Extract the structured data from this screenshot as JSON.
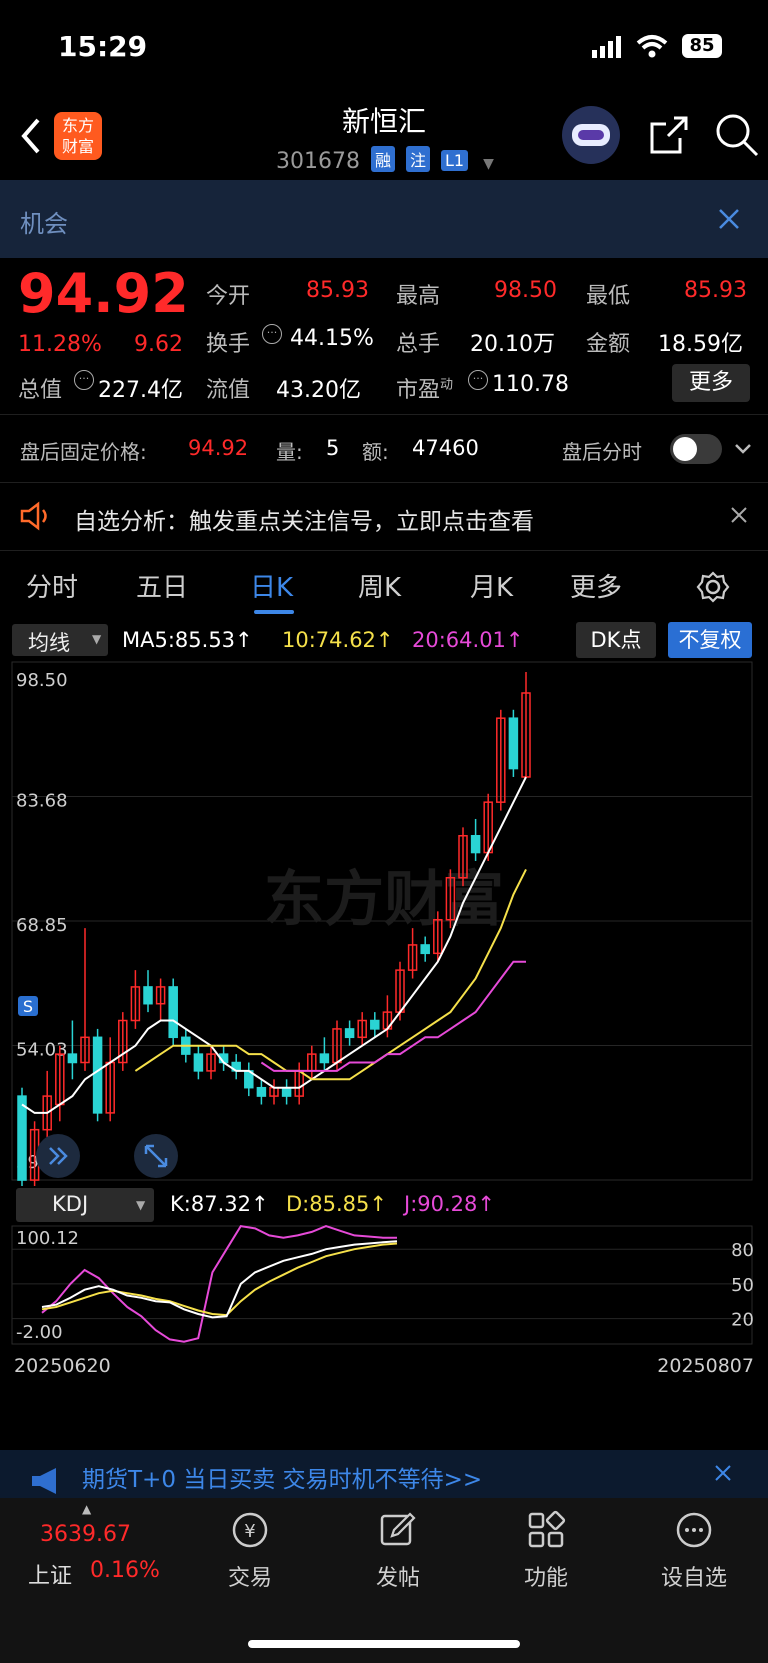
{
  "status_bar": {
    "time": "15:29",
    "battery": "85"
  },
  "header": {
    "title": "新恒汇",
    "code": "301678",
    "tags": [
      "融",
      "注",
      "L1"
    ],
    "logo_line1": "东方",
    "logo_line2": "财富"
  },
  "banner": {
    "text": "机会"
  },
  "quote": {
    "price": "94.92",
    "change_pct": "11.28%",
    "change": "9.62",
    "open_label": "今开",
    "open": "85.93",
    "high_label": "最高",
    "high": "98.50",
    "low_label": "最低",
    "low": "85.93",
    "turnover_label": "换手",
    "turnover": "44.15%",
    "volume_label": "总手",
    "volume": "20.10万",
    "amount_label": "金额",
    "amount": "18.59亿",
    "mcap_label": "总值",
    "mcap": "227.4亿",
    "float_label": "流值",
    "float_cap": "43.20亿",
    "pe_label": "市盈",
    "pe_sup": "动",
    "pe": "110.78",
    "more_button": "更多"
  },
  "after_hours": {
    "label": "盘后固定价格:",
    "price": "94.92",
    "vol_label": "量:",
    "vol": "5",
    "amt_label": "额:",
    "amt": "47460",
    "toggle_label": "盘后分时"
  },
  "notice": {
    "text": "自选分析：触发重点关注信号，立即点击查看"
  },
  "tabs": [
    "分时",
    "五日",
    "日K",
    "周K",
    "月K",
    "更多"
  ],
  "active_tab": "日K",
  "chart_data": {
    "type": "candlestick",
    "indicator_selector": "均线",
    "ma_labels": [
      "MA5:85.53↑",
      "10:74.62↑",
      "20:64.01↑"
    ],
    "dk_button": "DK点",
    "adjust_button": "不复权",
    "price_ticks": [
      "98.50",
      "83.68",
      "68.85",
      "54.03",
      "39.20"
    ],
    "watermark": "东方财富",
    "kdj_selector": "KDJ",
    "kdj_labels": [
      "K:87.32↑",
      "D:85.85↑",
      "J:90.28↑"
    ],
    "kdj_ticks_left": [
      "100.12",
      "-2.00"
    ],
    "kdj_ticks_right": [
      "80",
      "50",
      "20"
    ],
    "start_date": "20250620",
    "end_date": "20250807",
    "colors": {
      "up": "#ff2a2a",
      "down": "#2ad4d4",
      "ma5": "#ffffff",
      "ma10": "#f5e04a",
      "ma20": "#e64ad8"
    },
    "candles": [
      [
        48,
        38,
        49,
        37
      ],
      [
        38,
        44,
        45,
        36
      ],
      [
        44,
        48,
        51,
        43
      ],
      [
        47,
        53,
        54,
        45
      ],
      [
        53,
        52,
        57,
        50
      ],
      [
        52,
        55,
        68,
        51
      ],
      [
        55,
        46,
        56,
        45
      ],
      [
        46,
        52,
        55,
        45
      ],
      [
        52,
        57,
        58,
        51
      ],
      [
        57,
        61,
        63,
        56
      ],
      [
        61,
        59,
        63,
        58
      ],
      [
        59,
        61,
        62,
        57
      ],
      [
        61,
        55,
        62,
        54
      ],
      [
        55,
        53,
        56,
        52
      ],
      [
        53,
        51,
        54,
        50
      ],
      [
        51,
        53,
        54,
        50
      ],
      [
        53,
        52,
        54,
        51
      ],
      [
        52,
        51,
        53,
        50
      ],
      [
        51,
        49,
        52,
        48
      ],
      [
        49,
        48,
        50,
        47
      ],
      [
        48,
        49,
        50,
        47
      ],
      [
        49,
        48,
        50,
        47
      ],
      [
        48,
        51,
        52,
        47
      ],
      [
        51,
        53,
        54,
        50
      ],
      [
        53,
        52,
        55,
        51
      ],
      [
        52,
        56,
        57,
        51
      ],
      [
        56,
        55,
        57,
        54
      ],
      [
        55,
        57,
        58,
        54
      ],
      [
        57,
        56,
        58,
        55
      ],
      [
        56,
        58,
        60,
        55
      ],
      [
        58,
        63,
        64,
        57
      ],
      [
        63,
        66,
        68,
        62
      ],
      [
        66,
        65,
        67,
        64
      ],
      [
        65,
        69,
        70,
        64
      ],
      [
        69,
        74,
        75,
        68
      ],
      [
        74,
        79,
        80,
        73
      ],
      [
        79,
        77,
        81,
        76
      ],
      [
        77,
        83,
        84,
        76
      ],
      [
        83,
        93,
        94,
        82
      ],
      [
        93,
        87,
        94,
        86
      ],
      [
        86,
        96,
        98.5,
        86
      ]
    ],
    "ma5": [
      47,
      46,
      46,
      47,
      48,
      50,
      51,
      52,
      53,
      54,
      56,
      57,
      57,
      56,
      55,
      54,
      52,
      51,
      51,
      50,
      49,
      49,
      49,
      50,
      51,
      52,
      53,
      54,
      55,
      56,
      58,
      60,
      62,
      64,
      67,
      71,
      74,
      77,
      80,
      83,
      86
    ],
    "ma10": [
      null,
      null,
      null,
      null,
      null,
      null,
      null,
      null,
      null,
      51,
      52,
      53,
      54,
      54,
      54,
      54,
      54,
      54,
      53,
      53,
      52,
      51,
      51,
      50,
      50,
      50,
      50,
      51,
      52,
      53,
      54,
      55,
      56,
      57,
      58,
      60,
      62,
      65,
      68,
      72,
      75
    ],
    "ma20": [
      null,
      null,
      null,
      null,
      null,
      null,
      null,
      null,
      null,
      null,
      null,
      null,
      null,
      null,
      null,
      null,
      null,
      null,
      null,
      52,
      51,
      51,
      51,
      51,
      51,
      51,
      52,
      52,
      52,
      53,
      53,
      54,
      55,
      55,
      56,
      57,
      58,
      60,
      62,
      64,
      64
    ],
    "kdj_k": [
      30,
      32,
      38,
      45,
      48,
      45,
      40,
      38,
      35,
      34,
      28,
      24,
      21,
      22,
      50,
      60,
      65,
      70,
      73,
      76,
      80,
      82,
      84,
      85,
      86,
      87
    ],
    "kdj_d": [
      28,
      30,
      34,
      38,
      42,
      44,
      42,
      40,
      37,
      35,
      31,
      27,
      24,
      23,
      35,
      45,
      52,
      58,
      64,
      69,
      74,
      77,
      80,
      82,
      84,
      85
    ],
    "kdj_j": [
      25,
      35,
      50,
      62,
      55,
      42,
      30,
      22,
      10,
      2,
      0,
      3,
      60,
      80,
      100,
      98,
      92,
      90,
      92,
      95,
      100,
      96,
      92,
      91,
      90,
      90
    ]
  },
  "bottom_banner": {
    "text": "期货T+0 当日买卖 交易时机不等待>>"
  },
  "index_widget": {
    "value": "3639.67",
    "name": "上证",
    "pct": "0.16%"
  },
  "bottom_nav": [
    {
      "icon": "trade-icon",
      "label": "交易"
    },
    {
      "icon": "post-icon",
      "label": "发帖"
    },
    {
      "icon": "function-icon",
      "label": "功能"
    },
    {
      "icon": "more-icon",
      "label": "设自选"
    }
  ]
}
